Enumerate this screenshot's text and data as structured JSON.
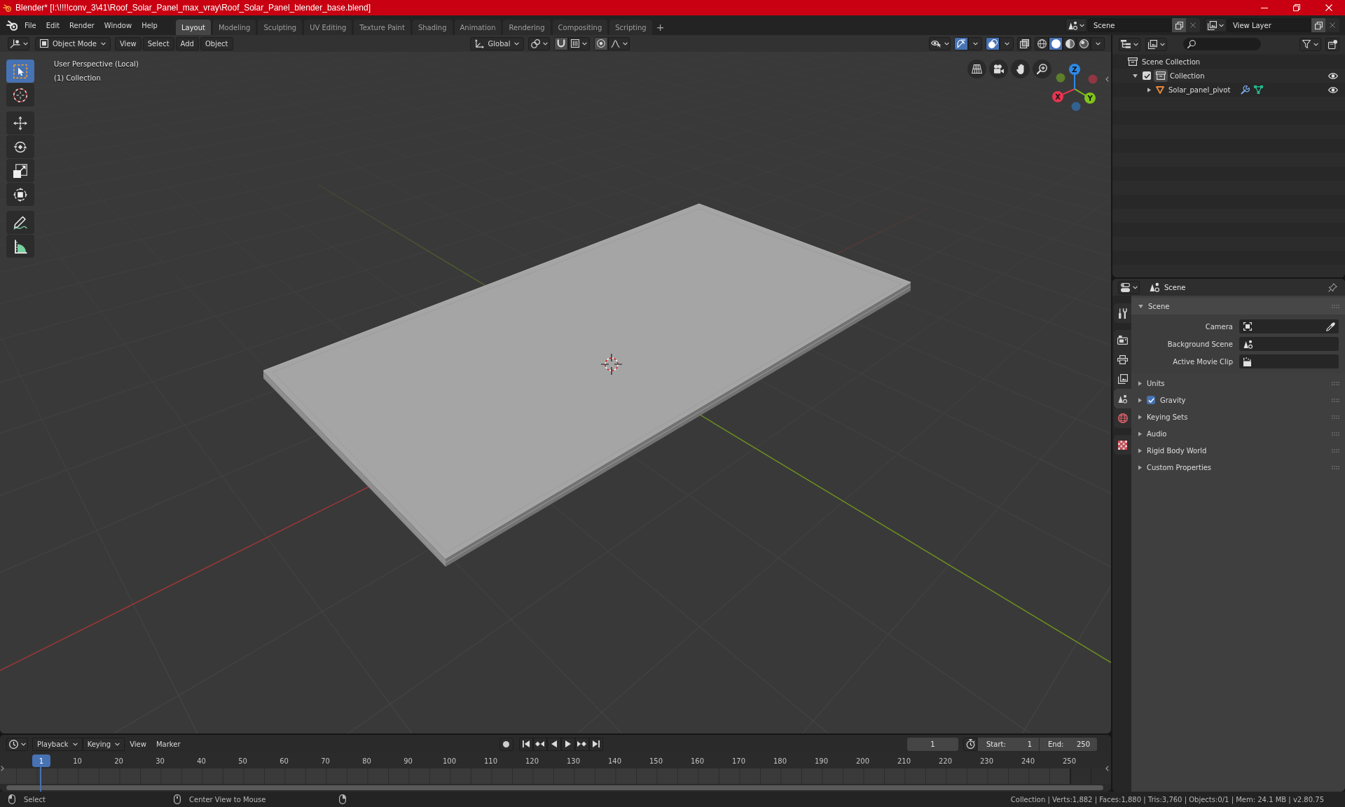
{
  "window": {
    "title": "Blender* [I:\\!!!!conv_3\\41\\Roof_Solar_Panel_max_vray\\Roof_Solar_Panel_blender_base.blend]"
  },
  "top_bar": {
    "menus": [
      "File",
      "Edit",
      "Render",
      "Window",
      "Help"
    ],
    "workspaces": [
      {
        "label": "Layout",
        "selected": true
      },
      {
        "label": "Modeling",
        "selected": false
      },
      {
        "label": "Sculpting",
        "selected": false
      },
      {
        "label": "UV Editing",
        "selected": false
      },
      {
        "label": "Texture Paint",
        "selected": false
      },
      {
        "label": "Shading",
        "selected": false
      },
      {
        "label": "Animation",
        "selected": false
      },
      {
        "label": "Rendering",
        "selected": false
      },
      {
        "label": "Compositing",
        "selected": false
      },
      {
        "label": "Scripting",
        "selected": false
      }
    ],
    "add_workspace": "+",
    "scene": "Scene",
    "view_layer": "View Layer"
  },
  "viewport": {
    "header": {
      "mode": "Object Mode",
      "menus": [
        "View",
        "Select",
        "Add",
        "Object"
      ],
      "orientation": "Global",
      "gizmos": true,
      "overlays": true,
      "xray": false,
      "shading": [
        {
          "kind": "wireframe",
          "selected": false
        },
        {
          "kind": "solid",
          "selected": true
        },
        {
          "kind": "material",
          "selected": false
        },
        {
          "kind": "rendered",
          "selected": false
        }
      ]
    },
    "view_name": "User Perspective (Local)",
    "collection": "(1) Collection",
    "tool_groups": [
      {
        "tools": [
          {
            "kind": "select-box",
            "selected": true
          },
          {
            "kind": "cursor",
            "selected": false
          }
        ]
      },
      {
        "tools": [
          {
            "kind": "move",
            "selected": false
          },
          {
            "kind": "rotate",
            "selected": false
          },
          {
            "kind": "scale",
            "selected": false
          },
          {
            "kind": "transform",
            "selected": false
          }
        ]
      },
      {
        "tools": [
          {
            "kind": "annotate",
            "selected": false
          },
          {
            "kind": "measure",
            "selected": false
          }
        ]
      }
    ],
    "axes": [
      {
        "label": "X",
        "color": "#e8344f"
      },
      {
        "label": "Y",
        "color": "#80c31b"
      },
      {
        "label": "Z",
        "color": "#2d8ae8"
      }
    ]
  },
  "outliner": {
    "tree": [
      {
        "label": "Scene Collection",
        "kind": "scene-collection",
        "children": [
          {
            "label": "Collection",
            "kind": "collection",
            "active": true,
            "expanded": true,
            "checked": true,
            "visible": true,
            "children": [
              {
                "label": "Solar_panel_pivot",
                "kind": "mesh-object",
                "expanded": false,
                "visible": true,
                "modifiers": true
              }
            ]
          }
        ]
      }
    ]
  },
  "properties": {
    "context": "Scene",
    "tab_groups": [
      {
        "tabs": [
          {
            "kind": "tool",
            "selected": false
          }
        ]
      },
      {
        "tabs": [
          {
            "kind": "render",
            "selected": false
          },
          {
            "kind": "output",
            "selected": false
          },
          {
            "kind": "view-layer",
            "selected": false
          },
          {
            "kind": "scene",
            "selected": true
          },
          {
            "kind": "world",
            "selected": false
          }
        ]
      },
      {
        "tabs": [
          {
            "kind": "texture",
            "selected": false
          }
        ]
      }
    ],
    "panels": [
      {
        "title": "Scene",
        "expanded": true,
        "fields": [
          {
            "label": "Camera",
            "kind": "camera",
            "eyedropper": true
          },
          {
            "label": "Background Scene",
            "kind": "scene"
          },
          {
            "label": "Active Movie Clip",
            "kind": "clip"
          }
        ]
      },
      {
        "title": "Units",
        "expanded": false
      },
      {
        "title": "Gravity",
        "expanded": false,
        "checked": true
      },
      {
        "title": "Keying Sets",
        "expanded": false
      },
      {
        "title": "Audio",
        "expanded": false
      },
      {
        "title": "Rigid Body World",
        "expanded": false
      },
      {
        "title": "Custom Properties",
        "expanded": false
      }
    ]
  },
  "timeline": {
    "menus": [
      {
        "label": "Playback",
        "kind": "dropdown"
      },
      {
        "label": "Keying",
        "kind": "dropdown"
      },
      {
        "label": "View",
        "kind": "menu"
      },
      {
        "label": "Marker",
        "kind": "menu"
      }
    ],
    "auto_keying": false,
    "current_frame": "1",
    "start": {
      "label": "Start:",
      "value": "1"
    },
    "end": {
      "label": "End:",
      "value": "250"
    },
    "playhead": "1",
    "ruler": [
      "10",
      "20",
      "30",
      "40",
      "50",
      "60",
      "70",
      "80",
      "90",
      "100",
      "110",
      "120",
      "130",
      "140",
      "150",
      "160",
      "170",
      "180",
      "190",
      "200",
      "210",
      "220",
      "230",
      "240",
      "250"
    ]
  },
  "status_bar": {
    "hints": [
      {
        "kind": "left-click",
        "label": "Select"
      },
      {
        "kind": "middle-click",
        "label": "Center View to Mouse"
      },
      {
        "kind": "right-click"
      }
    ],
    "stats": "Collection | Verts:1,882 | Faces:1,880 | Tris:3,760 | Objects:0/1 | Mem: 24.1 MB | v2.80.75"
  }
}
